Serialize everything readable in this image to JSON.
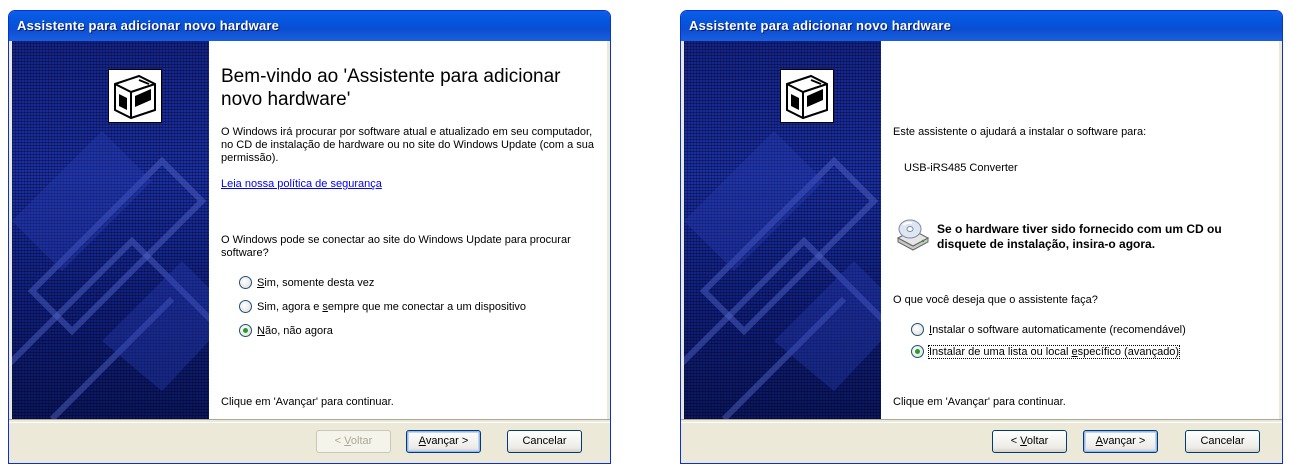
{
  "colors": {
    "title_bar": "#0553da",
    "dialog_bg": "#ece9d8",
    "link": "#0000ff",
    "radio_dot": "#21a121"
  },
  "icons": [
    "hardware-box-icon",
    "cd-drive-icon",
    "radio-button"
  ],
  "dialog1": {
    "title": "Assistente para adicionar novo hardware",
    "heading": "Bem-vindo ao 'Assistente para adicionar novo hardware'",
    "intro": "O Windows irá procurar por software atual e atualizado em seu computador, no CD de instalação de hardware ou no site do Windows Update (com a sua permissão).",
    "privacy_link": "Leia nossa política de segurança",
    "question": "O Windows pode se conectar ao site do Windows Update para procurar software?",
    "options": [
      {
        "label_pre": "",
        "accel": "S",
        "label_post": "im, somente desta vez",
        "selected": false
      },
      {
        "label_pre": "Sim, agora e ",
        "accel": "s",
        "label_post": "empre que me conectar a um dispositivo",
        "selected": false
      },
      {
        "label_pre": "",
        "accel": "N",
        "label_post": "ão, não agora",
        "selected": true
      }
    ],
    "footer": "Clique em 'Avançar' para continuar.",
    "buttons": {
      "back_pre": "< ",
      "back_accel": "V",
      "back_post": "oltar",
      "next_accel": "A",
      "next_post": "vançar >",
      "cancel": "Cancelar"
    }
  },
  "dialog2": {
    "title": "Assistente para adicionar novo hardware",
    "intro": "Este assistente o ajudará a instalar o software para:",
    "device": "USB-iRS485 Converter",
    "cd_message": "Se o hardware tiver sido fornecido com um CD ou disquete de instalação, insira-o agora.",
    "question": "O que você deseja que o assistente faça?",
    "options": [
      {
        "label_pre": "",
        "accel": "I",
        "label_post": "nstalar o software automaticamente (recomendável)",
        "selected": false
      },
      {
        "label_pre": "Instalar de uma lista ou local ",
        "accel": "e",
        "label_post": "specífico (avançado)",
        "selected": true
      }
    ],
    "footer": "Clique em 'Avançar' para continuar.",
    "buttons": {
      "back_pre": "< ",
      "back_accel": "V",
      "back_post": "oltar",
      "next_accel": "A",
      "next_post": "vançar >",
      "cancel": "Cancelar"
    }
  }
}
